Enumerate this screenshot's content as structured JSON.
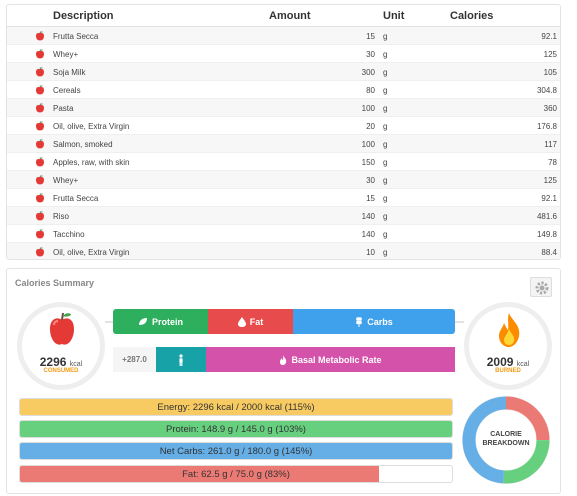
{
  "table": {
    "headers": {
      "description": "Description",
      "amount": "Amount",
      "unit": "Unit",
      "calories": "Calories"
    },
    "rows": [
      {
        "description": "Frutta Secca",
        "amount": "15",
        "unit": "g",
        "calories": "92.1"
      },
      {
        "description": "Whey+",
        "amount": "30",
        "unit": "g",
        "calories": "125"
      },
      {
        "description": "Soja Milk",
        "amount": "300",
        "unit": "g",
        "calories": "105"
      },
      {
        "description": "Cereals",
        "amount": "80",
        "unit": "g",
        "calories": "304.8"
      },
      {
        "description": "Pasta",
        "amount": "100",
        "unit": "g",
        "calories": "360"
      },
      {
        "description": "Oil, olive, Extra Virgin",
        "amount": "20",
        "unit": "g",
        "calories": "176.8"
      },
      {
        "description": "Salmon, smoked",
        "amount": "100",
        "unit": "g",
        "calories": "117"
      },
      {
        "description": "Apples, raw, with skin",
        "amount": "150",
        "unit": "g",
        "calories": "78"
      },
      {
        "description": "Whey+",
        "amount": "30",
        "unit": "g",
        "calories": "125"
      },
      {
        "description": "Frutta Secca",
        "amount": "15",
        "unit": "g",
        "calories": "92.1"
      },
      {
        "description": "Riso",
        "amount": "140",
        "unit": "g",
        "calories": "481.6"
      },
      {
        "description": "Tacchino",
        "amount": "140",
        "unit": "g",
        "calories": "149.8"
      },
      {
        "description": "Oil, olive, Extra Virgin",
        "amount": "10",
        "unit": "g",
        "calories": "88.4"
      }
    ],
    "row_icon": "apple-icon"
  },
  "summary": {
    "title": "Calories Summary",
    "settings_icon": "gear-icon",
    "consumed": {
      "value": "2296",
      "unit": "kcal",
      "label": "CONSUMED",
      "icon": "apple-icon"
    },
    "burned": {
      "value": "2009",
      "unit": "kcal",
      "label": "BURNED",
      "icon": "flame-icon"
    },
    "macros": {
      "protein": {
        "label": "Protein",
        "icon": "leaf-icon",
        "color": "#2eaf5d"
      },
      "fat": {
        "label": "Fat",
        "icon": "drop-icon",
        "color": "#e74b4b"
      },
      "carbs": {
        "label": "Carbs",
        "icon": "wheat-icon",
        "color": "#3fa0ec"
      }
    },
    "bmr": {
      "extra": "+287.0",
      "person_icon": "person-icon",
      "label": "Basal Metabolic Rate",
      "icon": "flame-icon",
      "color": "#d452aa"
    },
    "progress": {
      "energy": {
        "text": "Energy: 2296 kcal / 2000 kcal (115%)",
        "percent": 115,
        "color": "#f8cb62"
      },
      "protein": {
        "text": "Protein: 148.9 g / 145.0 g (103%)",
        "percent": 103,
        "color": "#67d07f"
      },
      "carbs": {
        "text": "Net Carbs: 261.0 g / 180.0 g (145%)",
        "percent": 145,
        "color": "#65aee6"
      },
      "fat": {
        "text": "Fat: 62.5 g / 75.0 g (83%)",
        "percent": 83,
        "color": "#ec7a74"
      }
    },
    "breakdown": {
      "line1": "CALORIE",
      "line2": "BREAKDOWN",
      "segments": [
        {
          "name": "fat",
          "color": "#ec7a74",
          "fraction": 0.25
        },
        {
          "name": "protein",
          "color": "#67d07f",
          "fraction": 0.26
        },
        {
          "name": "carbs",
          "color": "#65aee6",
          "fraction": 0.49
        }
      ]
    }
  }
}
